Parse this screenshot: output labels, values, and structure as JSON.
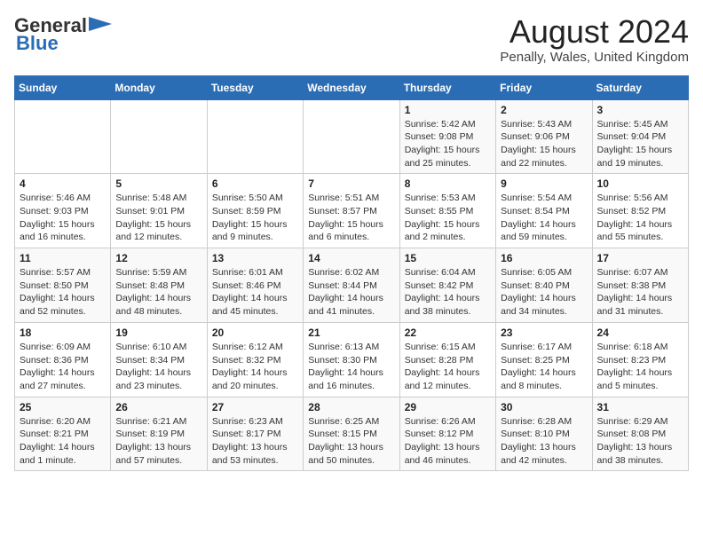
{
  "header": {
    "logo_general": "General",
    "logo_blue": "Blue",
    "month_title": "August 2024",
    "location": "Penally, Wales, United Kingdom"
  },
  "weekdays": [
    "Sunday",
    "Monday",
    "Tuesday",
    "Wednesday",
    "Thursday",
    "Friday",
    "Saturday"
  ],
  "weeks": [
    [
      {
        "day": "",
        "info": ""
      },
      {
        "day": "",
        "info": ""
      },
      {
        "day": "",
        "info": ""
      },
      {
        "day": "",
        "info": ""
      },
      {
        "day": "1",
        "info": "Sunrise: 5:42 AM\nSunset: 9:08 PM\nDaylight: 15 hours\nand 25 minutes."
      },
      {
        "day": "2",
        "info": "Sunrise: 5:43 AM\nSunset: 9:06 PM\nDaylight: 15 hours\nand 22 minutes."
      },
      {
        "day": "3",
        "info": "Sunrise: 5:45 AM\nSunset: 9:04 PM\nDaylight: 15 hours\nand 19 minutes."
      }
    ],
    [
      {
        "day": "4",
        "info": "Sunrise: 5:46 AM\nSunset: 9:03 PM\nDaylight: 15 hours\nand 16 minutes."
      },
      {
        "day": "5",
        "info": "Sunrise: 5:48 AM\nSunset: 9:01 PM\nDaylight: 15 hours\nand 12 minutes."
      },
      {
        "day": "6",
        "info": "Sunrise: 5:50 AM\nSunset: 8:59 PM\nDaylight: 15 hours\nand 9 minutes."
      },
      {
        "day": "7",
        "info": "Sunrise: 5:51 AM\nSunset: 8:57 PM\nDaylight: 15 hours\nand 6 minutes."
      },
      {
        "day": "8",
        "info": "Sunrise: 5:53 AM\nSunset: 8:55 PM\nDaylight: 15 hours\nand 2 minutes."
      },
      {
        "day": "9",
        "info": "Sunrise: 5:54 AM\nSunset: 8:54 PM\nDaylight: 14 hours\nand 59 minutes."
      },
      {
        "day": "10",
        "info": "Sunrise: 5:56 AM\nSunset: 8:52 PM\nDaylight: 14 hours\nand 55 minutes."
      }
    ],
    [
      {
        "day": "11",
        "info": "Sunrise: 5:57 AM\nSunset: 8:50 PM\nDaylight: 14 hours\nand 52 minutes."
      },
      {
        "day": "12",
        "info": "Sunrise: 5:59 AM\nSunset: 8:48 PM\nDaylight: 14 hours\nand 48 minutes."
      },
      {
        "day": "13",
        "info": "Sunrise: 6:01 AM\nSunset: 8:46 PM\nDaylight: 14 hours\nand 45 minutes."
      },
      {
        "day": "14",
        "info": "Sunrise: 6:02 AM\nSunset: 8:44 PM\nDaylight: 14 hours\nand 41 minutes."
      },
      {
        "day": "15",
        "info": "Sunrise: 6:04 AM\nSunset: 8:42 PM\nDaylight: 14 hours\nand 38 minutes."
      },
      {
        "day": "16",
        "info": "Sunrise: 6:05 AM\nSunset: 8:40 PM\nDaylight: 14 hours\nand 34 minutes."
      },
      {
        "day": "17",
        "info": "Sunrise: 6:07 AM\nSunset: 8:38 PM\nDaylight: 14 hours\nand 31 minutes."
      }
    ],
    [
      {
        "day": "18",
        "info": "Sunrise: 6:09 AM\nSunset: 8:36 PM\nDaylight: 14 hours\nand 27 minutes."
      },
      {
        "day": "19",
        "info": "Sunrise: 6:10 AM\nSunset: 8:34 PM\nDaylight: 14 hours\nand 23 minutes."
      },
      {
        "day": "20",
        "info": "Sunrise: 6:12 AM\nSunset: 8:32 PM\nDaylight: 14 hours\nand 20 minutes."
      },
      {
        "day": "21",
        "info": "Sunrise: 6:13 AM\nSunset: 8:30 PM\nDaylight: 14 hours\nand 16 minutes."
      },
      {
        "day": "22",
        "info": "Sunrise: 6:15 AM\nSunset: 8:28 PM\nDaylight: 14 hours\nand 12 minutes."
      },
      {
        "day": "23",
        "info": "Sunrise: 6:17 AM\nSunset: 8:25 PM\nDaylight: 14 hours\nand 8 minutes."
      },
      {
        "day": "24",
        "info": "Sunrise: 6:18 AM\nSunset: 8:23 PM\nDaylight: 14 hours\nand 5 minutes."
      }
    ],
    [
      {
        "day": "25",
        "info": "Sunrise: 6:20 AM\nSunset: 8:21 PM\nDaylight: 14 hours\nand 1 minute."
      },
      {
        "day": "26",
        "info": "Sunrise: 6:21 AM\nSunset: 8:19 PM\nDaylight: 13 hours\nand 57 minutes."
      },
      {
        "day": "27",
        "info": "Sunrise: 6:23 AM\nSunset: 8:17 PM\nDaylight: 13 hours\nand 53 minutes."
      },
      {
        "day": "28",
        "info": "Sunrise: 6:25 AM\nSunset: 8:15 PM\nDaylight: 13 hours\nand 50 minutes."
      },
      {
        "day": "29",
        "info": "Sunrise: 6:26 AM\nSunset: 8:12 PM\nDaylight: 13 hours\nand 46 minutes."
      },
      {
        "day": "30",
        "info": "Sunrise: 6:28 AM\nSunset: 8:10 PM\nDaylight: 13 hours\nand 42 minutes."
      },
      {
        "day": "31",
        "info": "Sunrise: 6:29 AM\nSunset: 8:08 PM\nDaylight: 13 hours\nand 38 minutes."
      }
    ]
  ]
}
